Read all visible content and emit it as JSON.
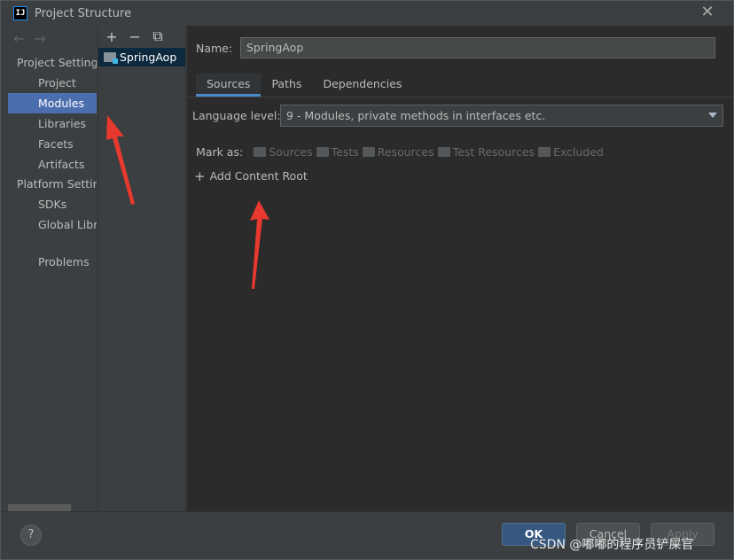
{
  "window": {
    "title": "Project Structure",
    "close_glyph": "✕",
    "app_icon_text": "IJ"
  },
  "nav": {
    "back_icon": "←",
    "forward_icon": "→",
    "project_settings_header": "Project Settings",
    "project_settings_items": [
      "Project",
      "Modules",
      "Libraries",
      "Facets",
      "Artifacts"
    ],
    "platform_settings_header": "Platform Settings",
    "platform_settings_items": [
      "SDKs",
      "Global Libraries"
    ],
    "problems": "Problems",
    "selected": "Modules"
  },
  "modules": {
    "add_glyph": "+",
    "remove_glyph": "−",
    "copy_glyph": "⧉",
    "items": [
      "SpringAop"
    ]
  },
  "module_detail": {
    "name_label": "Name:",
    "name_value": "SpringAop",
    "tabs": [
      "Sources",
      "Paths",
      "Dependencies"
    ],
    "active_tab": "Sources",
    "language_level_label": "Language level:",
    "language_level_value": "9 - Modules, private methods in interfaces etc.",
    "mark_as_label": "Mark as:",
    "mark_as_options": [
      "Sources",
      "Tests",
      "Resources",
      "Test Resources",
      "Excluded"
    ],
    "add_content_root": "Add Content Root"
  },
  "footer": {
    "help": "?",
    "ok": "OK",
    "cancel": "Cancel",
    "apply": "Apply"
  },
  "watermark": "CSDN @嘟嘟的程序员铲屎官",
  "colors": {
    "selection": "#4b6eaf",
    "ok_button": "#365880",
    "annotation_arrow": "#e8392f"
  }
}
